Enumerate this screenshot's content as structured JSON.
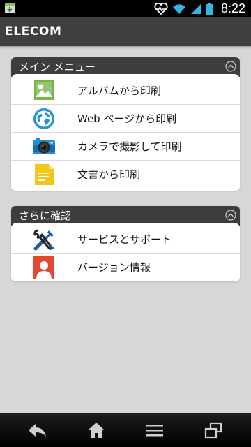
{
  "status_bar": {
    "time": "8:22"
  },
  "app_bar": {
    "brand": "ELECOM"
  },
  "main_menu": {
    "title": "メイン メニュー",
    "items": [
      {
        "label": "アルバムから印刷",
        "icon": "photo-album-icon"
      },
      {
        "label": "Web ページから印刷",
        "icon": "globe-icon"
      },
      {
        "label": "カメラで撮影して印刷",
        "icon": "camera-icon"
      },
      {
        "label": "文書から印刷",
        "icon": "document-icon"
      }
    ]
  },
  "more_menu": {
    "title": "さらに確認",
    "items": [
      {
        "label": "サービスとサポート",
        "icon": "tools-icon"
      },
      {
        "label": "バージョン情報",
        "icon": "user-icon"
      }
    ]
  },
  "nav": {
    "buttons": [
      "back-icon",
      "home-icon",
      "menu-icon",
      "recent-apps-icon"
    ]
  },
  "colors": {
    "background": "#d7d7d7",
    "app_bar": "#3f3f3f",
    "panel_header": "#3d3d3d",
    "album_green": "#7cb342",
    "globe_blue": "#2196d3",
    "document_yellow": "#f5c518",
    "tools_blue": "#1e5aa0",
    "user_red": "#e04a32"
  }
}
